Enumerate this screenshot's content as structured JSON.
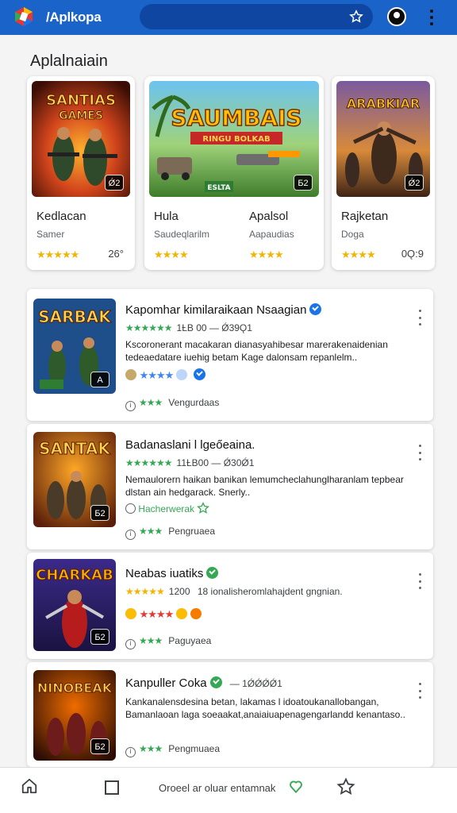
{
  "header": {
    "app_name": "/Aplkopa",
    "icons": [
      "app-logo-icon",
      "star-icon",
      "avatar",
      "more-vert-icon"
    ]
  },
  "section": {
    "title": "Aplalnaiain"
  },
  "featured": [
    {
      "art_title": "SANTIAS GAMES",
      "badge": "Ǿ2",
      "name": "Kedlacan",
      "sub": "Samer",
      "stars": "★★★★★",
      "count": "26°"
    },
    {
      "art_title": "SAUMBAIS",
      "art_sub": "RINGU BOLKAB",
      "banner": "ESLTA",
      "badge": "Б2",
      "name": "Hula",
      "sub": "Saudeqlarilm",
      "stars": "★★★★",
      "count": ""
    },
    {
      "art_title": "ARABKIAR",
      "badge": "Ǿ2",
      "name": "Rajketan",
      "sub": "Doga",
      "stars": "★★★★",
      "count": "0Ǫ:9"
    }
  ],
  "featured_extra": {
    "name": "Apalsol",
    "sub": "Aapaudias",
    "stars": "★★★★"
  },
  "list": [
    {
      "art_title": "SARBAK",
      "badge": "A",
      "title": "Kapomhar kimilaraikaan Nsaagian",
      "stars": "★★★★★★",
      "meta": "1ȽB 00 — Ǿ39Ǫ1",
      "desc": "Kscoronerant macakaran dianasyahibesar marerakenaidenian tedeaedatare iuehig betam Kage dalonsam repanlelm..",
      "rating_row": "★★★★",
      "foot_stars": "★★★",
      "foot_label": "Vengurdaas"
    },
    {
      "art_title": "SANTAK",
      "badge": "Б2",
      "title": "Badanaslani l lgeőeaina.",
      "stars": "★★★★★★",
      "meta": "11ȽB00 — Ǿ30Ǿ1",
      "desc": "Nemaulorern haikan banikan lemumcheclahunglharanlam tepbear dlstan ain hedgarack. Snerly..",
      "rating_row": "Hacherwerak",
      "foot_stars": "★★★",
      "foot_label": "Pengruaea"
    },
    {
      "art_title": "CHARKAB",
      "badge": "Б2",
      "title": "Neabas iuatiks",
      "stars": "★★★★★",
      "meta": "1200",
      "meta_extra": "18 ionalisheromlahajdent gngnian.",
      "rating_row": "★★★★",
      "foot_stars": "★★★",
      "foot_label": "Paguyaea"
    },
    {
      "art_title": "NINOBEAK",
      "badge": "Б2",
      "title": "Kanpuller Coka",
      "meta": "— 1ǾǾǾǾ1",
      "desc": "Kankanalensdesina betan, lakamas l idoatoukanallobangan, Bamanlaoan laga soeaakat,anaiaiuapenagengarlandd kenantaso..",
      "foot_stars": "★★★",
      "foot_label": "Pengmuaea"
    }
  ],
  "bottom_nav": {
    "label": "Oroeel ar oluar entamnak",
    "icons": [
      "home-icon",
      "square-icon",
      "heart-icon",
      "star-outline-icon"
    ]
  }
}
